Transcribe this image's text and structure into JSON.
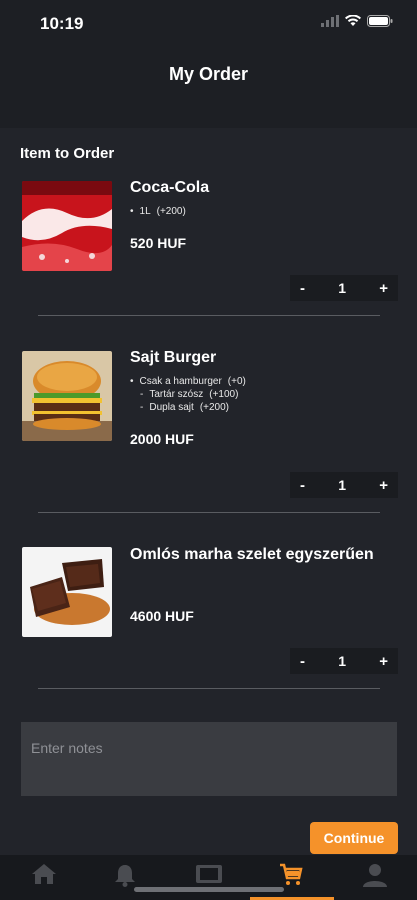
{
  "status": {
    "time": "10:19"
  },
  "header": {
    "title": "My Order"
  },
  "section_title": "Item to Order",
  "items": [
    {
      "name": "Coca-Cola",
      "options": [
        {
          "bullet": "•",
          "label": "1L",
          "price": "(+200)"
        }
      ],
      "price": "520 HUF",
      "quantity": "1"
    },
    {
      "name": "Sajt Burger",
      "options": [
        {
          "bullet": "•",
          "label": "Csak a hamburger",
          "price": "(+0)"
        },
        {
          "bullet": "-",
          "label": "Tartár szósz",
          "price": "(+100)"
        },
        {
          "bullet": "-",
          "label": "Dupla sajt",
          "price": "(+200)"
        }
      ],
      "price": "2000 HUF",
      "quantity": "1"
    },
    {
      "name": "Omlós marha szelet egyszerűen",
      "options": [],
      "price": "4600 HUF",
      "quantity": "1"
    }
  ],
  "stepper": {
    "minus": "-",
    "plus": "+"
  },
  "notes": {
    "placeholder": "Enter notes",
    "value": ""
  },
  "continue_label": "Continue",
  "tabs": [
    {
      "icon": "home-icon",
      "active": false
    },
    {
      "icon": "bell-icon",
      "active": false
    },
    {
      "icon": "tablet-icon",
      "active": false
    },
    {
      "icon": "cart-icon",
      "active": true
    },
    {
      "icon": "profile-icon",
      "active": false
    }
  ],
  "colors": {
    "accent": "#f5922a",
    "background": "#22242a",
    "header": "#1d1f24"
  }
}
